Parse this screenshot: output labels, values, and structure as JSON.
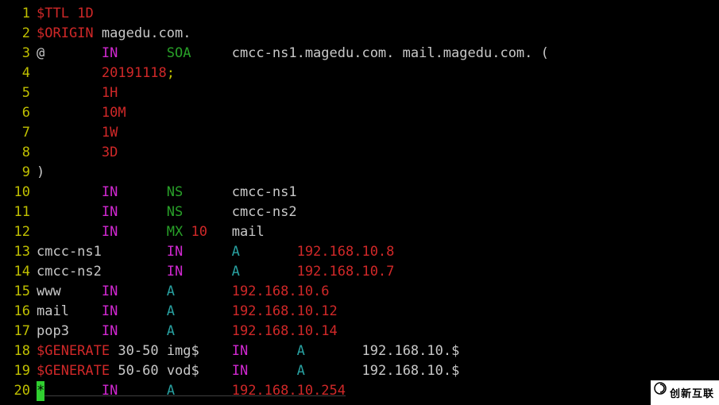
{
  "editor": {
    "lines": [
      {
        "n": "1",
        "segments": [
          {
            "t": "$TTL",
            "c": "c-red"
          },
          {
            "t": " ",
            "c": "c-default"
          },
          {
            "t": "1D",
            "c": "c-red"
          }
        ]
      },
      {
        "n": "2",
        "segments": [
          {
            "t": "$ORIGIN",
            "c": "c-red"
          },
          {
            "t": " ",
            "c": "c-default"
          },
          {
            "t": "magedu.com.",
            "c": "c-white"
          }
        ]
      },
      {
        "n": "3",
        "segments": [
          {
            "t": "@       ",
            "c": "c-white"
          },
          {
            "t": "IN",
            "c": "c-magenta"
          },
          {
            "t": "      ",
            "c": "c-default"
          },
          {
            "t": "SOA",
            "c": "c-green"
          },
          {
            "t": "     ",
            "c": "c-default"
          },
          {
            "t": "cmcc-ns1.magedu.com. mail.magedu.com. (",
            "c": "c-white"
          }
        ]
      },
      {
        "n": "4",
        "segments": [
          {
            "t": "        ",
            "c": "c-default"
          },
          {
            "t": "20191118",
            "c": "c-red"
          },
          {
            "t": ";",
            "c": "c-yellow"
          }
        ]
      },
      {
        "n": "5",
        "segments": [
          {
            "t": "        ",
            "c": "c-default"
          },
          {
            "t": "1H",
            "c": "c-red"
          }
        ]
      },
      {
        "n": "6",
        "segments": [
          {
            "t": "        ",
            "c": "c-default"
          },
          {
            "t": "10M",
            "c": "c-red"
          }
        ]
      },
      {
        "n": "7",
        "segments": [
          {
            "t": "        ",
            "c": "c-default"
          },
          {
            "t": "1W",
            "c": "c-red"
          }
        ]
      },
      {
        "n": "8",
        "segments": [
          {
            "t": "        ",
            "c": "c-default"
          },
          {
            "t": "3D",
            "c": "c-red"
          }
        ]
      },
      {
        "n": "9",
        "segments": [
          {
            "t": ")",
            "c": "c-white"
          }
        ]
      },
      {
        "n": "10",
        "segments": [
          {
            "t": "        ",
            "c": "c-default"
          },
          {
            "t": "IN",
            "c": "c-magenta"
          },
          {
            "t": "      ",
            "c": "c-default"
          },
          {
            "t": "NS",
            "c": "c-green"
          },
          {
            "t": "      ",
            "c": "c-default"
          },
          {
            "t": "cmcc-ns1",
            "c": "c-white"
          }
        ]
      },
      {
        "n": "11",
        "segments": [
          {
            "t": "        ",
            "c": "c-default"
          },
          {
            "t": "IN",
            "c": "c-magenta"
          },
          {
            "t": "      ",
            "c": "c-default"
          },
          {
            "t": "NS",
            "c": "c-green"
          },
          {
            "t": "      ",
            "c": "c-default"
          },
          {
            "t": "cmcc-ns2",
            "c": "c-white"
          }
        ]
      },
      {
        "n": "12",
        "segments": [
          {
            "t": "        ",
            "c": "c-default"
          },
          {
            "t": "IN",
            "c": "c-magenta"
          },
          {
            "t": "      ",
            "c": "c-default"
          },
          {
            "t": "MX",
            "c": "c-green"
          },
          {
            "t": " ",
            "c": "c-default"
          },
          {
            "t": "10",
            "c": "c-red"
          },
          {
            "t": "   ",
            "c": "c-default"
          },
          {
            "t": "mail",
            "c": "c-white"
          }
        ]
      },
      {
        "n": "13",
        "segments": [
          {
            "t": "cmcc-ns1        ",
            "c": "c-white"
          },
          {
            "t": "IN",
            "c": "c-magenta"
          },
          {
            "t": "      ",
            "c": "c-default"
          },
          {
            "t": "A",
            "c": "c-cyan"
          },
          {
            "t": "       ",
            "c": "c-default"
          },
          {
            "t": "192.168.10.8",
            "c": "c-red"
          }
        ]
      },
      {
        "n": "14",
        "segments": [
          {
            "t": "cmcc-ns2        ",
            "c": "c-white"
          },
          {
            "t": "IN",
            "c": "c-magenta"
          },
          {
            "t": "      ",
            "c": "c-default"
          },
          {
            "t": "A",
            "c": "c-cyan"
          },
          {
            "t": "       ",
            "c": "c-default"
          },
          {
            "t": "192.168.10.7",
            "c": "c-red"
          }
        ]
      },
      {
        "n": "15",
        "segments": [
          {
            "t": "www     ",
            "c": "c-white"
          },
          {
            "t": "IN",
            "c": "c-magenta"
          },
          {
            "t": "      ",
            "c": "c-default"
          },
          {
            "t": "A",
            "c": "c-cyan"
          },
          {
            "t": "       ",
            "c": "c-default"
          },
          {
            "t": "192.168.10.6",
            "c": "c-red"
          }
        ]
      },
      {
        "n": "16",
        "segments": [
          {
            "t": "mail    ",
            "c": "c-white"
          },
          {
            "t": "IN",
            "c": "c-magenta"
          },
          {
            "t": "      ",
            "c": "c-default"
          },
          {
            "t": "A",
            "c": "c-cyan"
          },
          {
            "t": "       ",
            "c": "c-default"
          },
          {
            "t": "192.168.10.12",
            "c": "c-red"
          }
        ]
      },
      {
        "n": "17",
        "segments": [
          {
            "t": "pop3    ",
            "c": "c-white"
          },
          {
            "t": "IN",
            "c": "c-magenta"
          },
          {
            "t": "      ",
            "c": "c-default"
          },
          {
            "t": "A",
            "c": "c-cyan"
          },
          {
            "t": "       ",
            "c": "c-default"
          },
          {
            "t": "192.168.10.14",
            "c": "c-red"
          }
        ]
      },
      {
        "n": "18",
        "segments": [
          {
            "t": "$GENERATE",
            "c": "c-red"
          },
          {
            "t": " ",
            "c": "c-default"
          },
          {
            "t": "30-50",
            "c": "c-white"
          },
          {
            "t": " ",
            "c": "c-default"
          },
          {
            "t": "img$    ",
            "c": "c-white"
          },
          {
            "t": "IN",
            "c": "c-magenta"
          },
          {
            "t": "      ",
            "c": "c-default"
          },
          {
            "t": "A",
            "c": "c-cyan"
          },
          {
            "t": "       ",
            "c": "c-default"
          },
          {
            "t": "192.168.10.$",
            "c": "c-white"
          }
        ]
      },
      {
        "n": "19",
        "segments": [
          {
            "t": "$GENERATE",
            "c": "c-red"
          },
          {
            "t": " ",
            "c": "c-default"
          },
          {
            "t": "50-60",
            "c": "c-white"
          },
          {
            "t": " ",
            "c": "c-default"
          },
          {
            "t": "vod$    ",
            "c": "c-white"
          },
          {
            "t": "IN",
            "c": "c-magenta"
          },
          {
            "t": "      ",
            "c": "c-default"
          },
          {
            "t": "A",
            "c": "c-cyan"
          },
          {
            "t": "       ",
            "c": "c-default"
          },
          {
            "t": "192.168.10.$",
            "c": "c-white"
          }
        ]
      },
      {
        "n": "20",
        "cursor": true,
        "segments": [
          {
            "t": "*",
            "c": "cursor-block"
          },
          {
            "t": "       ",
            "c": "c-default"
          },
          {
            "t": "IN",
            "c": "c-magenta"
          },
          {
            "t": "      ",
            "c": "c-default"
          },
          {
            "t": "A",
            "c": "c-cyan"
          },
          {
            "t": "       ",
            "c": "c-default"
          },
          {
            "t": "192.168.10.254",
            "c": "c-red"
          }
        ]
      }
    ]
  },
  "watermark": {
    "text": "创新互联"
  }
}
